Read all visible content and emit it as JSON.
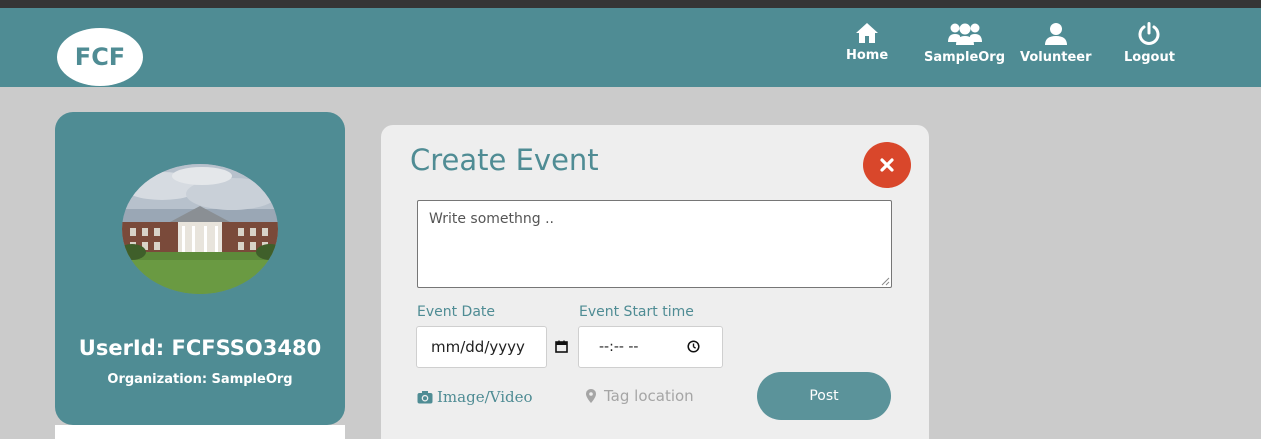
{
  "app": {
    "logo_text": "FCF"
  },
  "nav": {
    "items": [
      {
        "label": "Home",
        "icon": "home-icon"
      },
      {
        "label": "SampleOrg",
        "icon": "group-icon"
      },
      {
        "label": "Volunteer",
        "icon": "user-icon"
      },
      {
        "label": "Logout",
        "icon": "power-icon"
      }
    ],
    "active": "Volunteer"
  },
  "profile": {
    "userid": "UserId: FCFSSO3480",
    "organization": "Organization: SampleOrg",
    "avatar": "building-photo"
  },
  "create_event": {
    "title": "Create Event",
    "close_icon": "close-icon",
    "textarea_placeholder": "Write somethng ..",
    "event_date_label": "Event Date",
    "event_date_placeholder": "mm/dd/yyyy",
    "event_time_label": "Event Start time",
    "event_time_placeholder": "--:-- --",
    "media_label": "Image/Video",
    "location_label": "Tag location",
    "post_label": "Post"
  },
  "colors": {
    "brand": "#4f8c94",
    "close": "#d9472b",
    "background": "#cbcbcb",
    "card": "#eeeeee"
  }
}
